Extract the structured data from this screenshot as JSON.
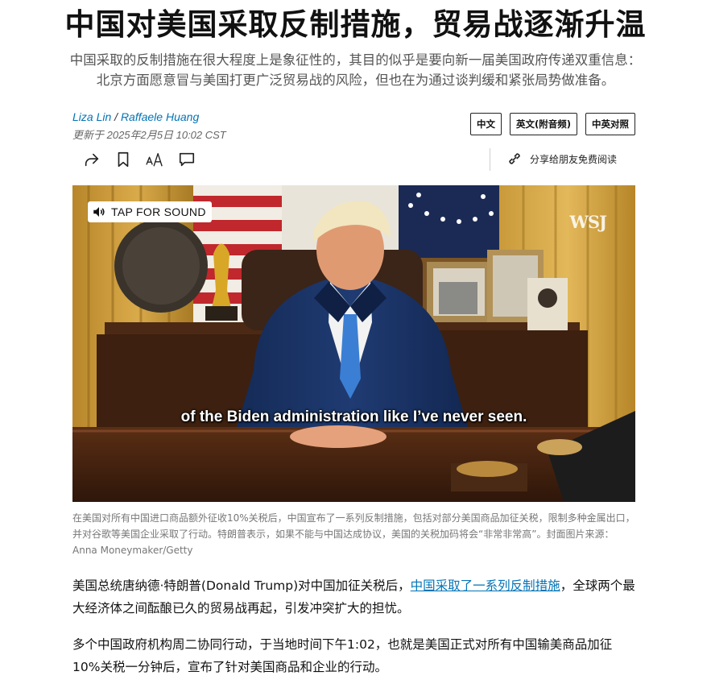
{
  "article": {
    "headline": "中国对美国采取反制措施，贸易战逐渐升温",
    "dek_line1": "中国采取的反制措施在很大程度上是象征性的，其目的似乎是要向新一届美国政府传递双重信息：",
    "dek_line2": "北京方面愿意冒与美国打更广泛贸易战的风险，但也在为通过谈判缓和紧张局势做准备。",
    "authors": [
      "Liza Lin",
      "Raffaele Huang"
    ],
    "author_separator": "/",
    "updated": "更新于 2025年2月5日 10:02 CST"
  },
  "language_buttons": [
    "中文",
    "英文(附音频)",
    "中英对照"
  ],
  "toolbar": {
    "icons": [
      "share-icon",
      "bookmark-icon",
      "text-size-icon",
      "comment-icon",
      "link-icon"
    ],
    "share_free_label": "分享给朋友免费阅读"
  },
  "media": {
    "tap_for_sound": "TAP FOR SOUND",
    "watermark": "WSJ",
    "subtitle": "of the Biden administration like I’ve never seen."
  },
  "caption": "在美国对所有中国进口商品额外征收10%关税后，中国宣布了一系列反制措施，包括对部分美国商品加征关税，限制多种金属出口，并对谷歌等美国企业采取了行动。特朗普表示，如果不能与中国达成协议，美国的关税加码将会“非常非常高”。封面图片来源：Anna Moneymaker/Getty",
  "body": {
    "p1_before": "美国总统唐纳德·特朗普(Donald Trump)对中国加征关税后，",
    "p1_link": "中国采取了一系列反制措施",
    "p1_after": "，全球两个最大经济体之间酝酿已久的贸易战再起，引发冲突扩大的担忧。",
    "p2": "多个中国政府机构周二协同行动，于当地时间下午1:02，也就是美国正式对所有中国输美商品加征10%关税一分钟后，宣布了针对美国商品和企业的行动。"
  },
  "colors": {
    "link": "#0274b6",
    "caption": "#777777",
    "dek": "#555555"
  }
}
